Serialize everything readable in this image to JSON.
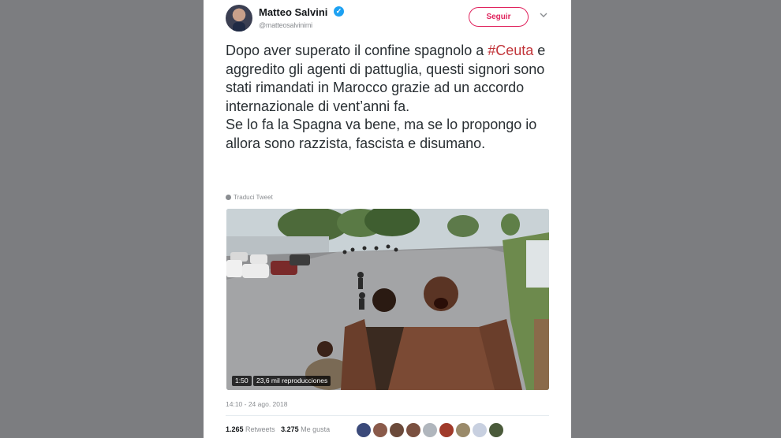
{
  "author": {
    "display_name": "Matteo Salvini",
    "verified_mark": "✓",
    "handle": "@matteosalvinimi"
  },
  "follow_button": {
    "label": "Seguir",
    "color": "#e0245e"
  },
  "tweet": {
    "text_before_hashtag": "Dopo aver superato il confine spagnolo a ",
    "hashtag": "#Ceuta",
    "text_after_hashtag": " e aggredito gli agenti di pattuglia, questi signori sono stati rimandati in Marocco grazie ad un accordo internazionale di vent’anni fa.",
    "second_paragraph": "Se lo fa la Spagna va bene, ma se lo propongo io allora sono razzista, fascista e disumano.",
    "translate_label": "Traduci Tweet"
  },
  "video": {
    "duration": "1:50",
    "views": "23,6 mil reproducciones"
  },
  "timestamp": "14:10 - 24 ago. 2018",
  "stats": {
    "retweets_count": "1.265",
    "retweets_label": "Retweets",
    "likes_count": "3.275",
    "likes_label": "Me gusta"
  },
  "liker_avatar_colors": [
    "#3b4a7a",
    "#8a5a4a",
    "#6b4a3a",
    "#7a5040",
    "#b0b6bd",
    "#a03a2a",
    "#9a8a6a",
    "#c8d0e0",
    "#4a5a3a"
  ]
}
